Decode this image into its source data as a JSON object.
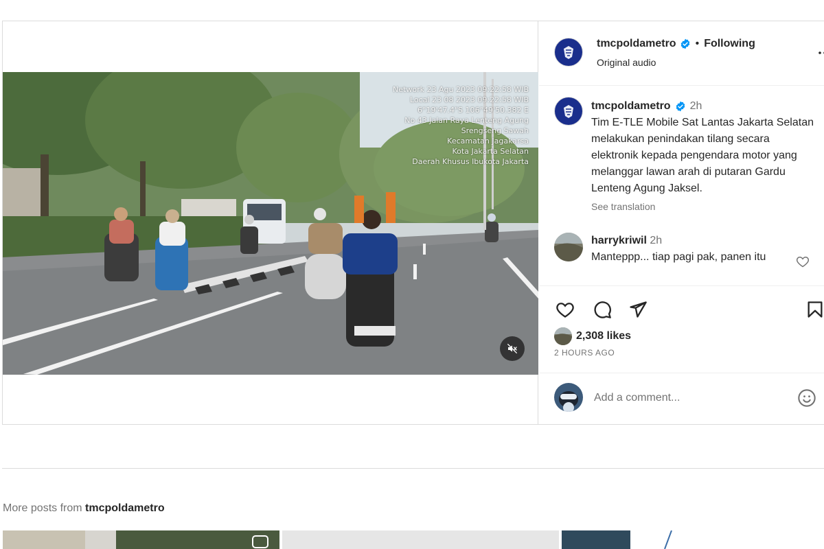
{
  "post": {
    "username": "tmcpoldametro",
    "following_label": "Following",
    "separator": "•",
    "audio_label": "Original audio",
    "caption": {
      "username": "tmcpoldametro",
      "time": "2h",
      "text": "Tim E-TLE Mobile Sat Lantas Jakarta Selatan melakukan penindakan tilang secara elektronik kepada pengendara motor yang melanggar lawan arah di putaran Gardu Lenteng Agung Jaksel.",
      "see_translation": "See translation"
    },
    "comments": [
      {
        "username": "harrykriwil",
        "time": "2h",
        "text": "Manteppp... tiap pagi pak, panen itu"
      }
    ],
    "likes_label": "2,308 likes",
    "time_ago": "2 HOURS AGO",
    "add_comment_placeholder": "Add a comment..."
  },
  "video_overlay": {
    "lines": [
      "Network 23 Agu 2023 09:22:58 WIB",
      "Local 23 08 2023 09:22:58 WIB",
      "6°19'47.4\"S 106°49'50.382 E",
      "No 43 Jalan Raya Lenteng Agung",
      "Srengseng Sawah",
      "Kecamatan Jagakarsa",
      "Kota Jakarta Selatan",
      "Daerah Khusus Ibukota Jakarta"
    ]
  },
  "more_posts": {
    "prefix": "More posts from ",
    "username": "tmcpoldametro"
  },
  "colors": {
    "verified": "#0095f6",
    "text": "#262626",
    "secondary": "#737373",
    "border": "#dbdbdb"
  },
  "icons": {
    "like": "heart-icon",
    "comment": "comment-icon",
    "share": "send-icon",
    "save": "bookmark-icon",
    "more": "more-horizontal-icon",
    "mute": "muted-speaker-icon",
    "emoji": "emoji-icon",
    "verified": "verified-badge-icon"
  }
}
